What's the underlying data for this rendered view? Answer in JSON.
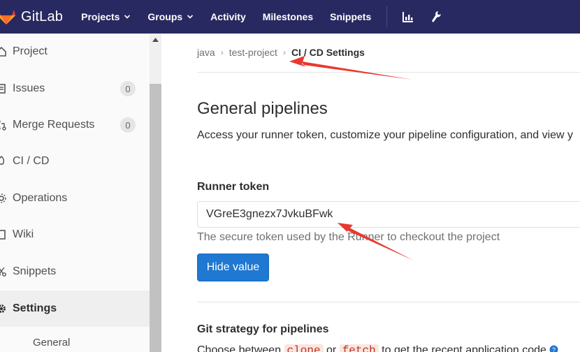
{
  "topnav": {
    "brand": "GitLab",
    "items": [
      {
        "label": "Projects",
        "dropdown": true
      },
      {
        "label": "Groups",
        "dropdown": true
      },
      {
        "label": "Activity",
        "dropdown": false
      },
      {
        "label": "Milestones",
        "dropdown": false
      },
      {
        "label": "Snippets",
        "dropdown": false
      }
    ],
    "icons": [
      "chart-icon",
      "wrench-icon"
    ]
  },
  "sidebar": {
    "items": [
      {
        "label": "Project",
        "icon": "home-icon"
      },
      {
        "label": "Issues",
        "icon": "issues-icon",
        "count": "0"
      },
      {
        "label": "Merge Requests",
        "icon": "merge-request-icon",
        "count": "0"
      },
      {
        "label": "CI / CD",
        "icon": "rocket-icon"
      },
      {
        "label": "Operations",
        "icon": "cloud-gear-icon"
      },
      {
        "label": "Wiki",
        "icon": "book-icon"
      },
      {
        "label": "Snippets",
        "icon": "scissors-icon"
      },
      {
        "label": "Settings",
        "icon": "gear-icon",
        "active": true
      }
    ],
    "sub_item": "General"
  },
  "breadcrumb": {
    "items": [
      "java",
      "test-project"
    ],
    "current": "CI / CD Settings"
  },
  "main": {
    "section_title": "General pipelines",
    "section_desc": "Access your runner token, customize your pipeline configuration, and view y",
    "runner_label": "Runner token",
    "runner_token": "VGreE3gnezx7JvkuBFwk",
    "runner_help": "The secure token used by the Runner to checkout the project",
    "hide_button": "Hide value",
    "git_strategy_title": "Git strategy for pipelines",
    "git_strategy_desc": {
      "prefix": "Choose between",
      "opt1": "clone",
      "middle": "or",
      "opt2": "fetch",
      "suffix": "to get the recent application code"
    }
  },
  "colors": {
    "topnav_bg": "#292961",
    "primary_button": "#1f78d1",
    "annotation_arrow": "#e8392f"
  }
}
